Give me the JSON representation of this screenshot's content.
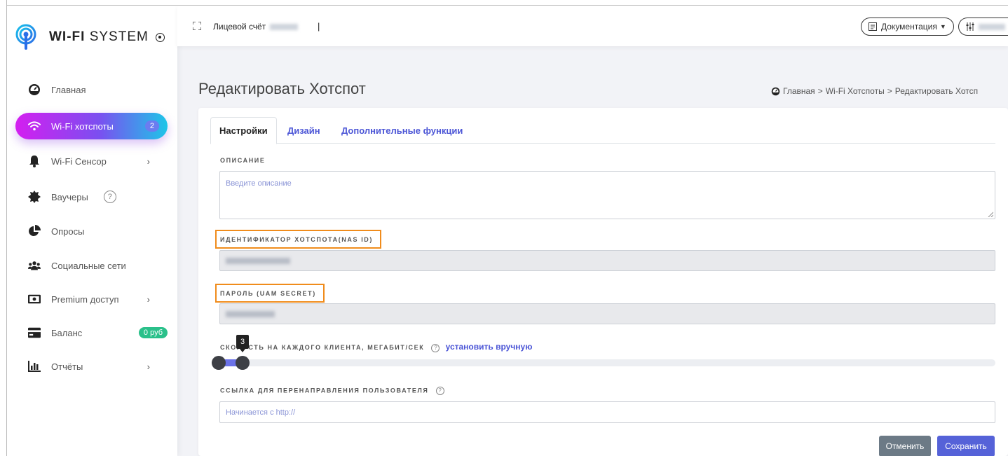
{
  "brand": {
    "bold": "WI-FI",
    "rest": " SYSTEM"
  },
  "sidebar": {
    "items": [
      {
        "label": "Главная",
        "icon": "dashboard-icon"
      },
      {
        "label": "Wi-Fi хотспоты",
        "icon": "wifi-icon",
        "badge": "2",
        "active": true
      },
      {
        "label": "Wi-Fi Сенсор",
        "icon": "bell-icon"
      },
      {
        "label": "Ваучеры",
        "icon": "badge-icon",
        "help": "?"
      },
      {
        "label": "Опросы",
        "icon": "pie-chart-icon"
      },
      {
        "label": "Социальные сети",
        "icon": "users-icon"
      },
      {
        "label": "Premium доступ",
        "icon": "money-icon"
      },
      {
        "label": "Баланс",
        "icon": "card-icon",
        "badge": "0 руб"
      },
      {
        "label": "Отчёты",
        "icon": "bar-chart-icon"
      }
    ],
    "chevron": "›"
  },
  "topbar": {
    "account_label": "Лицевой счёт",
    "separator": "|",
    "docs_label": "Документация"
  },
  "page": {
    "title": "Редактировать Хотспот",
    "breadcrumb": [
      "Главная",
      ">",
      "Wi-Fi Хотспоты",
      ">",
      "Редактировать Хотсп"
    ]
  },
  "tabs": [
    "Настройки",
    "Дизайн",
    "Дополнительные функции"
  ],
  "form": {
    "description_label": "ОПИСАНИЕ",
    "description_placeholder": "Введите описание",
    "nas_id_label": "ИДЕНТИФИКАТОР ХОТСПОТА(NAS ID)",
    "uam_secret_label": "ПАРОЛЬ (UAM SECRET)",
    "speed_label": "СКОР",
    "speed_label_rest": "СТЬ НА КАЖДОГО КЛИЕНТА, МЕГАБИТ/СЕК",
    "speed_manual_link": "установить вручную",
    "speed_value": "3",
    "redirect_label": "ССЫЛКА ДЛЯ ПЕРЕНАПРАВЛЕНИЯ ПОЛЬЗОВАТЕЛЯ",
    "redirect_placeholder": "Начинается с http://",
    "help_glyph": "?"
  },
  "actions": {
    "cancel": "Отменить",
    "save": "Сохранить"
  },
  "colors": {
    "accent": "#5562d8",
    "highlight": "#f08c1c",
    "balance_badge": "#2ac08a"
  }
}
